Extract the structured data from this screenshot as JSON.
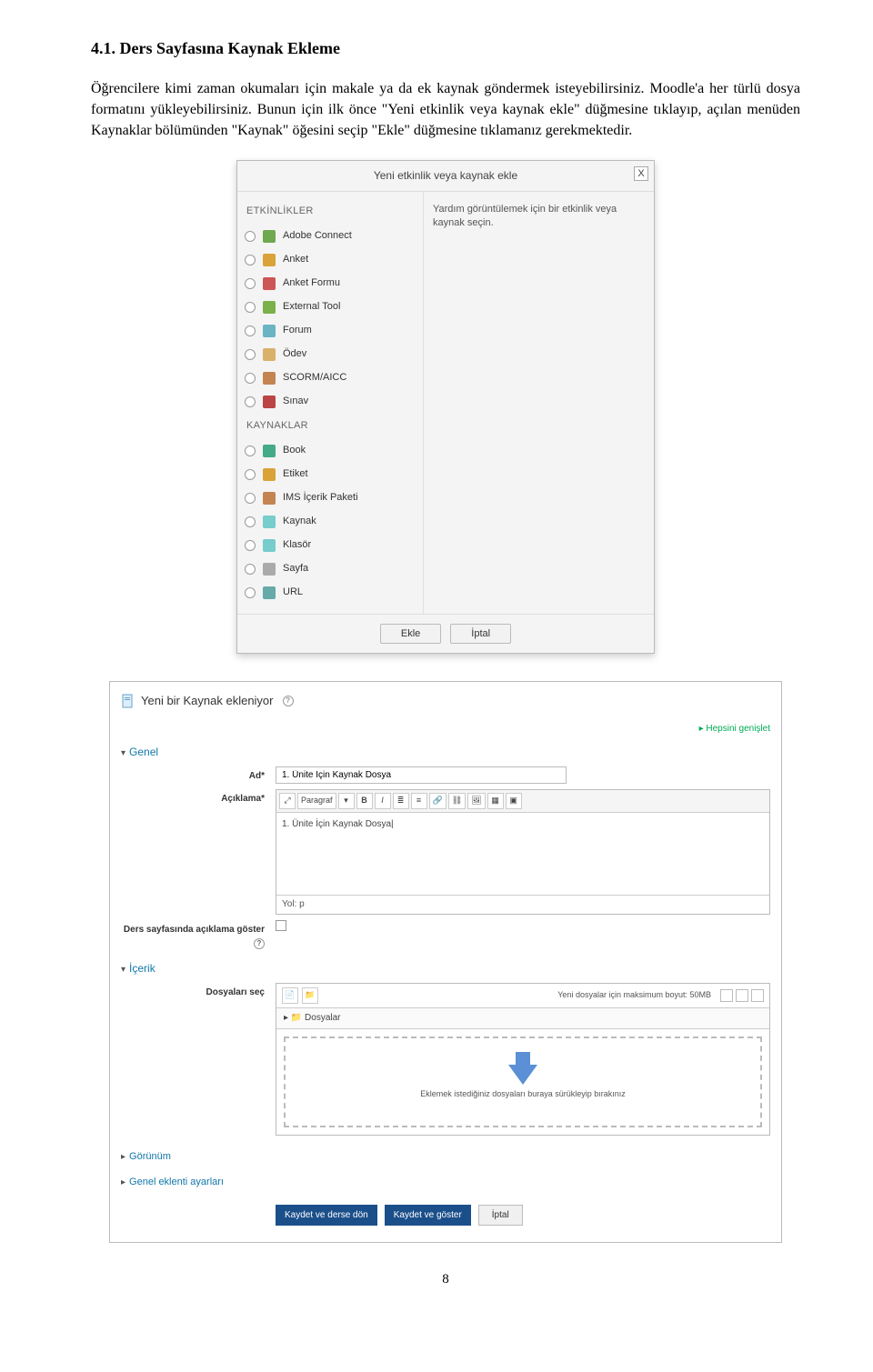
{
  "heading": "4.1. Ders Sayfasına Kaynak Ekleme",
  "paragraph": "Öğrencilere kimi zaman okumaları için makale ya da ek kaynak göndermek isteyebilirsiniz. Moodle'a her türlü dosya formatını yükleyebilirsiniz. Bunun için ilk önce \"Yeni etkinlik veya kaynak ekle\" düğmesine tıklayıp, açılan menüden Kaynaklar bölümünden \"Kaynak\" öğesini seçip \"Ekle\" düğmesine tıklamanız gerekmektedir.",
  "modal": {
    "title": "Yeni etkinlik veya kaynak ekle",
    "close": "X",
    "sections": {
      "activities": "ETKİNLİKLER",
      "resources": "KAYNAKLAR"
    },
    "activities": [
      {
        "label": "Adobe Connect",
        "iconColor": "#6ea84f"
      },
      {
        "label": "Anket",
        "iconColor": "#d9a33a"
      },
      {
        "label": "Anket Formu",
        "iconColor": "#c55"
      },
      {
        "label": "External Tool",
        "iconColor": "#7bb04a"
      },
      {
        "label": "Forum",
        "iconColor": "#6bb4c4"
      },
      {
        "label": "Ödev",
        "iconColor": "#d9b16b"
      },
      {
        "label": "SCORM/AICC",
        "iconColor": "#c48452"
      },
      {
        "label": "Sınav",
        "iconColor": "#b44"
      }
    ],
    "resources": [
      {
        "label": "Book",
        "iconColor": "#4a8"
      },
      {
        "label": "Etiket",
        "iconColor": "#d9a33a"
      },
      {
        "label": "IMS İçerik Paketi",
        "iconColor": "#c48452"
      },
      {
        "label": "Kaynak",
        "iconColor": "#7cc"
      },
      {
        "label": "Klasör",
        "iconColor": "#7cc"
      },
      {
        "label": "Sayfa",
        "iconColor": "#aaa"
      },
      {
        "label": "URL",
        "iconColor": "#6aa"
      }
    ],
    "help_text": "Yardım görüntülemek için bir etkinlik veya kaynak seçin.",
    "buttons": {
      "add": "Ekle",
      "cancel": "İptal"
    }
  },
  "form": {
    "header_icon_color": "#7cc",
    "header_text": "Yeni bir Kaynak ekleniyor",
    "expand": "Hepsini genişlet",
    "sections": {
      "genel": "Genel",
      "icerik": "İçerik",
      "gorunum": "Görünüm",
      "genel_eklenti": "Genel eklenti ayarları"
    },
    "labels": {
      "ad": "Ad*",
      "aciklama": "Açıklama*",
      "ders_sayfa": "Ders sayfasında açıklama göster",
      "dosya": "Dosyaları seç"
    },
    "ad_value": "1. Ünite İçin Kaynak Dosya",
    "aciklama_value": "1. Ünite İçin Kaynak Dosya|",
    "rte_footer": "Yol: p",
    "file_path_label": "Dosyalar",
    "drop_hint": "Eklemek istediğiniz dosyaları buraya sürükleyip bırakınız",
    "maxsize": "Yeni dosyalar için maksimum boyut: 50MB",
    "toolbar": {
      "paragraph": "Paragraf",
      "b": "B",
      "i": "I"
    },
    "buttons": {
      "save_return": "Kaydet ve derse dön",
      "save_show": "Kaydet ve göster",
      "cancel": "İptal"
    }
  },
  "page_number": "8"
}
